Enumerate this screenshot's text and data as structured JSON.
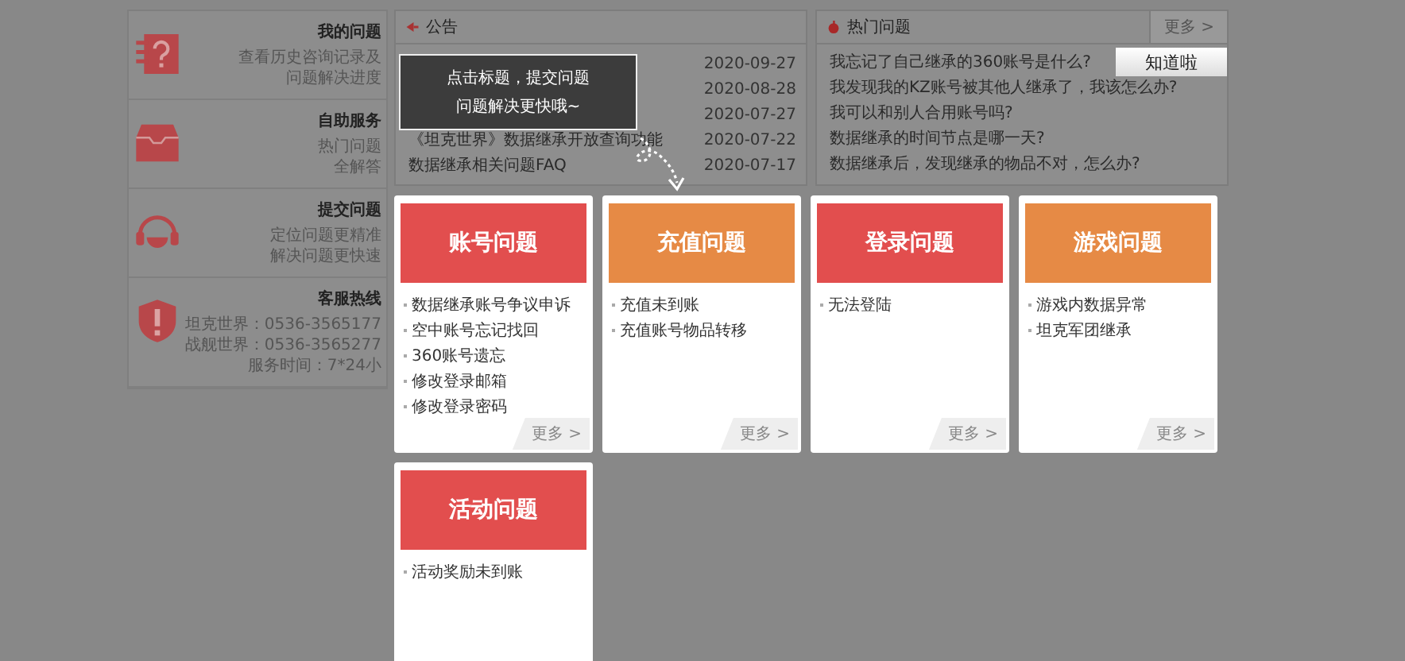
{
  "sidebar": {
    "items": [
      {
        "kind": "question",
        "title": "我的问题",
        "lines": [
          "查看历史咨询记录及",
          "问题解决进度"
        ]
      },
      {
        "kind": "box",
        "title": "自助服务",
        "lines": [
          "热门问题",
          "全解答"
        ]
      },
      {
        "kind": "headset",
        "title": "提交问题",
        "lines": [
          "定位问题更精准",
          "解决问题更快速"
        ]
      },
      {
        "kind": "shield",
        "title": "客服热线",
        "lines": [
          "坦克世界：0536-3565177",
          "战舰世界：0536-3565277",
          "服务时间：7*24小"
        ]
      }
    ]
  },
  "announcements": {
    "title": "公告",
    "rows": [
      {
        "date": "2020-09-27"
      },
      {
        "date": "2020-08-28"
      },
      {
        "date": "2020-07-27"
      },
      {
        "title": "《坦克世界》数据继承开放查询功能",
        "date": "2020-07-22"
      },
      {
        "title": "数据继承相关问题FAQ",
        "date": "2020-07-17"
      }
    ],
    "tooltip": {
      "lines": [
        "点击标题，提交问题",
        "问题解决更快哦~"
      ]
    }
  },
  "hot_questions": {
    "title": "热门问题",
    "more": "更多 >",
    "items": [
      "我忘记了自己继承的360账号是什么?",
      "我发现我的KZ账号被其他人继承了，我该怎么办?",
      "我可以和别人合用账号吗?",
      "数据继承的时间节点是哪一天?",
      "数据继承后，发现继承的物品不对，怎么办?"
    ],
    "dismiss_button": "知道啦"
  },
  "categories": [
    {
      "title": "账号问题",
      "color": "#e24e4e",
      "items": [
        "数据继承账号争议申诉",
        "空中账号忘记找回",
        "360账号遗忘",
        "修改登录邮箱",
        "修改登录密码"
      ],
      "more": "更多 >"
    },
    {
      "title": "充值问题",
      "color": "#e68a45",
      "items": [
        "充值未到账",
        "充值账号物品转移"
      ],
      "more": "更多 >"
    },
    {
      "title": "登录问题",
      "color": "#e24e4e",
      "items": [
        "无法登陆"
      ],
      "more": "更多 >"
    },
    {
      "title": "游戏问题",
      "color": "#e68a45",
      "items": [
        "游戏内数据异常",
        "坦克军团继承"
      ],
      "more": "更多 >"
    },
    {
      "title": "活动问题",
      "color": "#e24e4e",
      "items": [
        "活动奖励未到账"
      ]
    }
  ]
}
